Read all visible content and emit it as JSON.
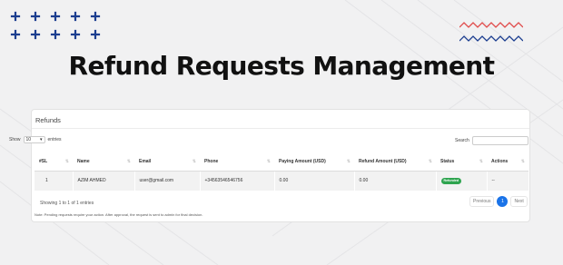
{
  "page": {
    "title": "Refund Requests Management"
  },
  "card": {
    "title": "Refunds"
  },
  "controls": {
    "show_label": "Show",
    "entries_value": "10",
    "entries_suffix": "entries",
    "search_label": "Search",
    "search_value": ""
  },
  "table": {
    "columns": [
      {
        "label": "#SL"
      },
      {
        "label": "Name"
      },
      {
        "label": "Email"
      },
      {
        "label": "Phone"
      },
      {
        "label": "Paying Amount (USD)"
      },
      {
        "label": "Refund Amount (USD)"
      },
      {
        "label": "Status"
      },
      {
        "label": "Actions"
      }
    ],
    "rows": [
      {
        "sl": "1",
        "name": "AZIM AHMED",
        "email": "user@gmail.com",
        "phone": "+34563546546756",
        "paying_amount": "0.00",
        "refund_amount": "0.00",
        "status": "Refunded",
        "actions": "--"
      }
    ]
  },
  "footer": {
    "showing": "Showing 1 to 1 of 1 entries",
    "prev": "Previous",
    "page": "1",
    "next": "Next"
  },
  "note": "Note: Pending requests require your action. After approval, the request is sent to admin for final decision.",
  "colors": {
    "background": "#f1f1f2",
    "plus_marks": "#1b3d8f",
    "zigzag_red": "#e04a4a",
    "zigzag_blue": "#1b3d8f",
    "status_green": "#2ea44f",
    "page_active": "#1a73e8"
  }
}
